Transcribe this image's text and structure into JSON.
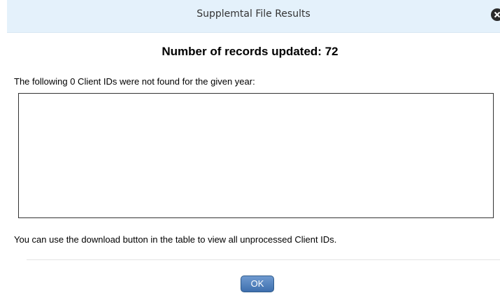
{
  "dialog": {
    "title": "Supplemtal File Results",
    "close_icon": "close-circle-icon"
  },
  "results": {
    "heading": "Number of records updated: 72",
    "not_found_label": "The following 0 Client IDs were not found for the given year:",
    "not_found_ids": [],
    "hint": "You can use the download button in the table to view all unprocessed Client IDs."
  },
  "footer": {
    "ok_label": "OK"
  },
  "colors": {
    "titlebar_bg": "#e4f1fb",
    "button_blue": "#4a7bbd"
  }
}
